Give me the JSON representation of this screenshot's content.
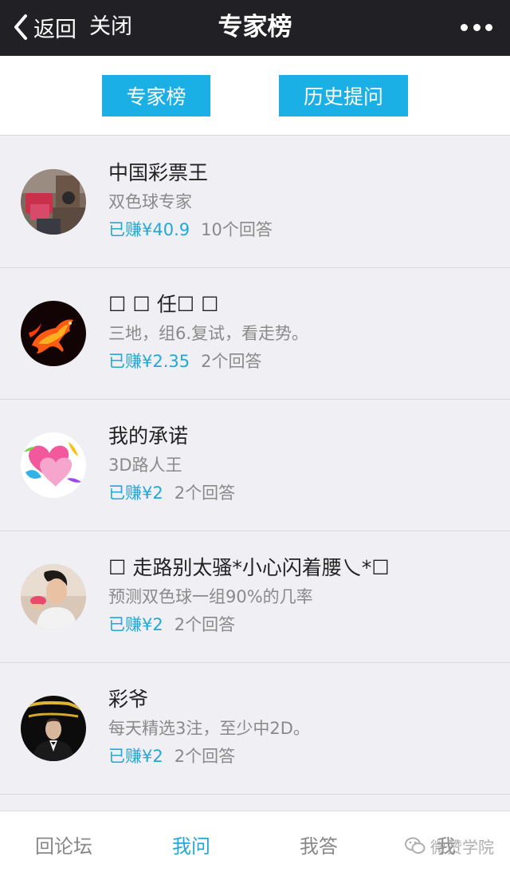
{
  "navbar": {
    "back_label": "返回",
    "close_label": "关闭",
    "title": "专家榜"
  },
  "tabs": [
    "专家榜",
    "历史提问"
  ],
  "experts": [
    {
      "name": "中国彩票王",
      "desc": "双色球专家",
      "earned": "已赚¥40.9",
      "answers": "10个回答",
      "avatar": "photo-avatar"
    },
    {
      "name": "☐ ☐ 任☐ ☐",
      "desc": "三地，组6.复试，看走势。",
      "earned": "已赚¥2.35",
      "answers": "2个回答",
      "avatar": "fire-horse-avatar"
    },
    {
      "name": "我的承诺",
      "desc": "3D路人王",
      "earned": "已赚¥2",
      "answers": "2个回答",
      "avatar": "heart-avatar"
    },
    {
      "name": "☐ 走路别太骚*小心闪着腰乀*☐",
      "desc": "预测双色球一组90%的几率",
      "earned": "已赚¥2",
      "answers": "2个回答",
      "avatar": "person-avatar"
    },
    {
      "name": "彩爷",
      "desc": "每天精选3注，至少中2D。",
      "earned": "已赚¥2",
      "answers": "2个回答",
      "avatar": "tuxedo-avatar"
    }
  ],
  "bottom_nav": [
    "回论坛",
    "我问",
    "我答",
    "我"
  ],
  "active_bottom": "我问",
  "watermark": "微赞学院",
  "colors": {
    "accent": "#1ab0e6",
    "navbar": "#212125",
    "earned_text": "#22a8d6"
  }
}
